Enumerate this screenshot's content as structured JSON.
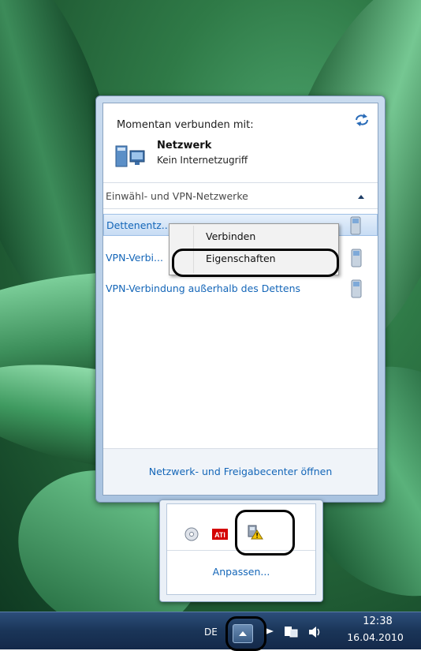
{
  "flyout": {
    "connected_header": "Momentan verbunden mit:",
    "network": {
      "name": "Netzwerk",
      "status": "Kein Internetzugriff"
    },
    "section_header": "Einwähl- und VPN-Netzwerke",
    "vpn_items": [
      {
        "label": "Dettenentz..."
      },
      {
        "label": "VPN-Verbi..."
      },
      {
        "label": "VPN-Verbindung außerhalb des Dettens"
      }
    ],
    "footer_link": "Netzwerk- und Freigabecenter öffnen"
  },
  "context_menu": {
    "items": [
      "Verbinden",
      "Eigenschaften"
    ]
  },
  "tray": {
    "icons": [
      "disc-icon",
      "ati-icon",
      "network-warning-icon"
    ],
    "customize_label": "Anpassen..."
  },
  "taskbar": {
    "language": "DE",
    "time": "12:38",
    "date": "16.04.2010"
  },
  "colors": {
    "link_blue": "#1466b8",
    "taskbar": "#1a3558",
    "highlight_outline": "#000000"
  }
}
